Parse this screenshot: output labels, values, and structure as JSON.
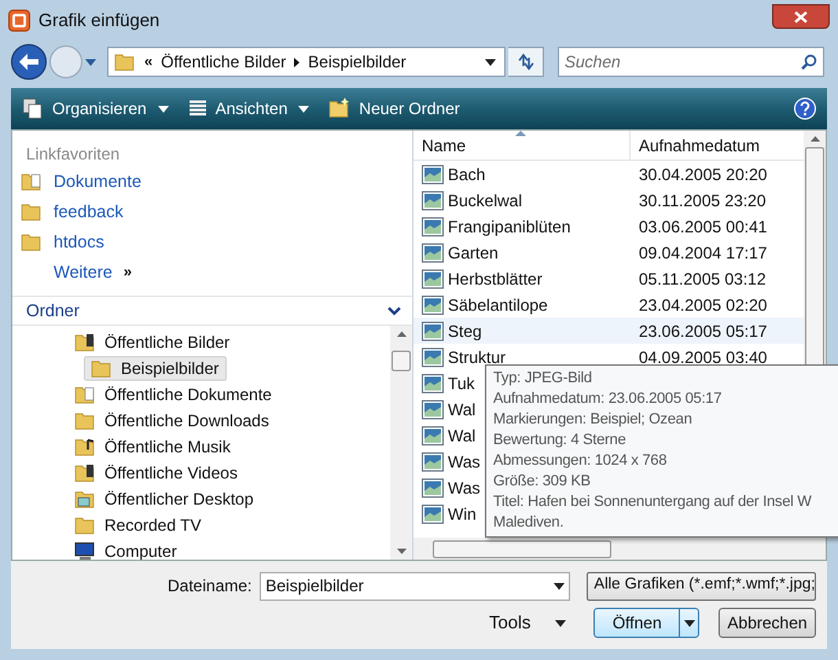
{
  "window": {
    "title": "Grafik einfügen"
  },
  "address": {
    "overflow": "«",
    "path": [
      "Öffentliche Bilder",
      "Beispielbilder"
    ]
  },
  "search": {
    "placeholder": "Suchen"
  },
  "toolbar": [
    {
      "label": "Organisieren",
      "kind": "organize",
      "menu": true
    },
    {
      "label": "Ansichten",
      "kind": "views",
      "menu": true
    },
    {
      "label": "Neuer Ordner",
      "kind": "newfolder",
      "menu": false
    }
  ],
  "favorites": {
    "heading": "Linkfavoriten",
    "items": [
      {
        "label": "Dokumente",
        "kind": "documents"
      },
      {
        "label": "feedback",
        "kind": "folder"
      },
      {
        "label": "htdocs",
        "kind": "folder"
      }
    ],
    "more": "Weitere",
    "more_glyph": "»"
  },
  "folders": {
    "heading": "Ordner",
    "expanded": true,
    "tree": [
      {
        "children": [
          {
            "label": "Öffentliche Bilder",
            "kind": "pictures",
            "selected": false,
            "children": [
              {
                "label": "Beispielbilder",
                "kind": "folder",
                "selected": true
              }
            ]
          },
          {
            "label": "Öffentliche Dokumente",
            "kind": "documents",
            "selected": false
          },
          {
            "label": "Öffentliche Downloads",
            "kind": "folder",
            "selected": false
          },
          {
            "label": "Öffentliche Musik",
            "kind": "music",
            "selected": false
          },
          {
            "label": "Öffentliche Videos",
            "kind": "pictures",
            "selected": false
          },
          {
            "label": "Öffentlicher Desktop",
            "kind": "desktop",
            "selected": false
          },
          {
            "label": "Recorded TV",
            "kind": "folder",
            "selected": false
          }
        ]
      },
      {
        "label": "Computer",
        "kind": "computer",
        "selected": false
      }
    ]
  },
  "table": {
    "columns": [
      {
        "label": "Name",
        "sorted": true
      },
      {
        "label": "Aufnahmedatum",
        "sorted": false
      }
    ],
    "rows": [
      {
        "name": "Bach",
        "date": "30.04.2005 20:20",
        "hovered": false
      },
      {
        "name": "Buckelwal",
        "date": "30.11.2005 23:20",
        "hovered": false
      },
      {
        "name": "Frangipaniblüten",
        "date": "03.06.2005 00:41",
        "hovered": false
      },
      {
        "name": "Garten",
        "date": "09.04.2004 17:17",
        "hovered": false
      },
      {
        "name": "Herbstblätter",
        "date": "05.11.2005 03:12",
        "hovered": false
      },
      {
        "name": "Säbelantilope",
        "date": "23.04.2005 02:20",
        "hovered": false
      },
      {
        "name": "Steg",
        "date": "23.06.2005 05:17",
        "hovered": true
      },
      {
        "name": "Struktur",
        "date": "04.09.2005 03:40",
        "hovered": false
      },
      {
        "name": "Tuk",
        "hovered": false
      },
      {
        "name": "Wal",
        "hovered": false
      },
      {
        "name": "Wal",
        "hovered": false
      },
      {
        "name": "Was",
        "hovered": false
      },
      {
        "name": "Was",
        "hovered": false
      },
      {
        "name": "Win",
        "hovered": false
      }
    ]
  },
  "tooltip": [
    "Typ: JPEG-Bild",
    "Aufnahmedatum: 23.06.2005 05:17",
    "Markierungen: Beispiel; Ozean",
    "Bewertung: 4 Sterne",
    "Abmessungen: 1024 x 768",
    "Größe: 309 KB",
    "Titel: Hafen bei Sonnenuntergang auf der Insel W",
    "Malediven."
  ],
  "filename": {
    "label": "Dateiname:",
    "value": "Beispielbilder"
  },
  "filter": {
    "value": "Alle Grafiken (*.emf;*.wmf;*.jpg;"
  },
  "buttons": {
    "tools": "Tools",
    "open": "Öffnen",
    "cancel": "Abbrechen"
  }
}
